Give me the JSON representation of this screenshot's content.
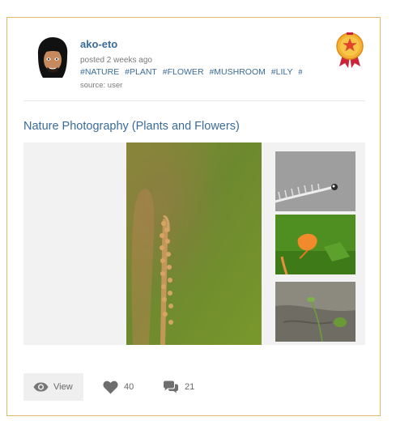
{
  "post": {
    "username": "ako-eto",
    "posted": "posted 2 weeks ago",
    "tags": [
      "#NATURE",
      "#PLANT",
      "#FLOWER",
      "#MUSHROOM",
      "#LILY",
      "#C"
    ],
    "source": "source: user",
    "title": "Nature Photography (Plants and Flowers)"
  },
  "actions": {
    "view_label": "View",
    "likes": "40",
    "comments": "21"
  },
  "icons": {
    "view": "eye-icon",
    "like": "heart-icon",
    "comment": "comment-bubbles-icon",
    "badge": "award-medal-icon"
  },
  "colors": {
    "link": "#3a6b99",
    "card_border": "#e3b96a",
    "muted": "#7a7a7a"
  }
}
